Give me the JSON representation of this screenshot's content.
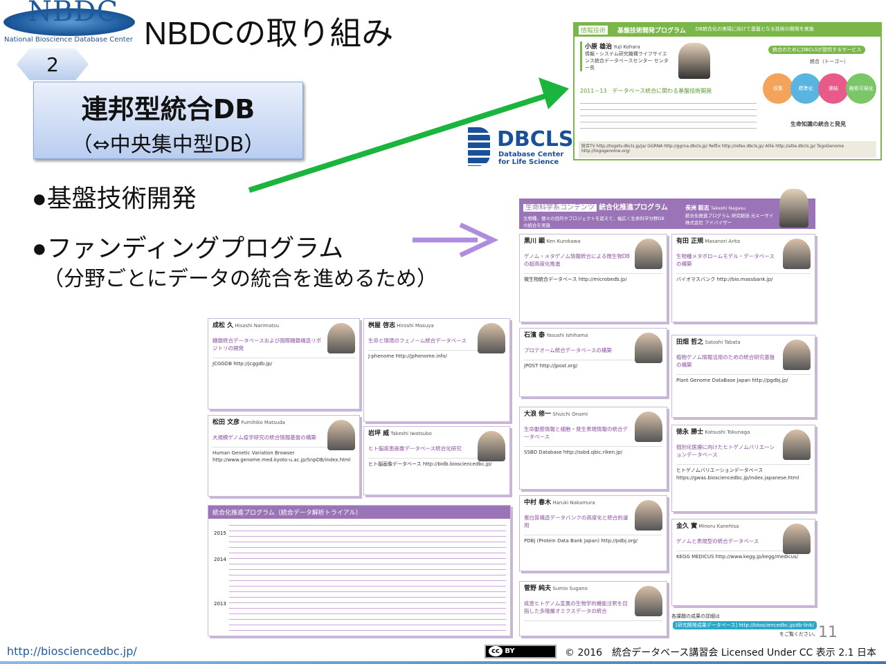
{
  "logo": {
    "text": "NBDC",
    "subtitle": "National Bioscience Database Center"
  },
  "title": "NBDCの取り組み",
  "step_number": "2",
  "box": {
    "line1": "連邦型統合DB",
    "line2": "（⇔中央集中型DB）"
  },
  "bullets": [
    {
      "text": "●基盤技術開発"
    },
    {
      "text": "●ファンディングプログラム",
      "sub": "（分野ごとにデータの統合を進めるため）"
    }
  ],
  "dbcls": {
    "name": "DBCLS",
    "line1": "Database Center",
    "line2": "for Life Science"
  },
  "tech_panel": {
    "tag": "情報技術",
    "title": "基盤技術開発プログラム",
    "desc": "DB統合化の実現に向けて基盤となる技術の開発を実施",
    "person": "小原 雄治",
    "person_en": "Yuji Kohara",
    "affil": "情報・システム研究機構ライフサイエンス統合データベースセンター センター長",
    "period": "2011－13",
    "topic": "データベース統合に関わる基盤技術開発",
    "service_title": "統合のためにDBCLSが提供するサービス",
    "service_sub": "統合（トーゴー）",
    "circles": [
      "収集",
      "標準化",
      "連結",
      "検索可視化"
    ],
    "result": "生命知識の統合と発見",
    "links": "統合TV http://togotv.dbcls.jp/ja/  GGRNA http://ggrna.dbcls.jp/  RefEx http://refex.dbcls.jp/  Allie http://allie.dbcls.jp/  TogoGenome http://togogenome.org/"
  },
  "life_panel": {
    "tag": "生命科学系コンテンツ",
    "title": "統合化推進プログラム",
    "desc": "生物種、個々の目的やプロジェクトを超えて、幅広く生命科学分野DBの統合を実施",
    "person": "長洲 毅志",
    "person_en": "Takeshi Nagasu",
    "role": "統合化推進プログラム 研究総括 元エーザイ株式会社 アドバイザー"
  },
  "cards": [
    {
      "name": "黒川 顕",
      "en": "Ken Kurokawa",
      "topic": "ゲノム・メタゲノム情報統合による微生物DBの超高度化推進",
      "db": "微生物統合データベース http://microbedb.jp/"
    },
    {
      "name": "有田 正規",
      "en": "Masanori Arita",
      "topic": "生物種メタボロームモデル・データベースの構築",
      "db": "バイオマスバンク http://bio.massbank.jp/"
    },
    {
      "name": "石濱 泰",
      "en": "Yasushi Ishihama",
      "topic": "プロテオーム統合データベースの構築",
      "db": "jPOST http://jpost.org/"
    },
    {
      "name": "田畑 哲之",
      "en": "Satoshi Tabata",
      "topic": "植物ゲノム情報活用のための統合研究基盤の構築",
      "db": "Plant Genome DataBase Japan http://pgdbj.jp/"
    },
    {
      "name": "大浪 修一",
      "en": "Shuichi Onami",
      "topic": "生命動態情報と細胞・発生表現情報の統合データベース",
      "db": "SSBD Database http://ssbd.qbic.riken.jp/"
    },
    {
      "name": "徳永 勝士",
      "en": "Katsushi Tokunaga",
      "topic": "個別化医療に向けたヒトゲノムバリエーションデータベース",
      "db": "ヒトゲノムバリエーションデータベース https://gwas.biosciencedbc.jp/index.japanese.html"
    },
    {
      "name": "中村 春木",
      "en": "Haruki Nakamura",
      "topic": "蛋白質構造データバンクの高度化と統合的運用",
      "db": "PDBj (Protein Data Bank Japan) http://pdbj.org/"
    },
    {
      "name": "金久 實",
      "en": "Minoru Kanehisa",
      "topic": "ゲノムと表現型の統合データベース",
      "db": "KEGG MEDICUS http://www.kegg.jp/kegg/medicus/"
    },
    {
      "name": "菅野 純夫",
      "en": "Sumio Sugano",
      "topic": "疾患ヒトゲノム変異の生物学的機能注釈を目指した多階層オミクスデータの統合",
      "db": ""
    },
    {
      "name": "成松 久",
      "en": "Hisashi Narimatsu",
      "topic": "糖鎖統合データベースおよび国際糖鎖構造リポジトリの開発",
      "db": "JCGGDB http://jcggdb.jp/"
    },
    {
      "name": "桝屋 啓志",
      "en": "Hiroshi Masuya",
      "topic": "生命と環境のフェノーム統合データベース",
      "db": "J-phenome http://jphenome.info/"
    },
    {
      "name": "松田 文彦",
      "en": "Fumihiko Matsuda",
      "topic": "大規模ゲノム疫学研究の統合情報基盤の構築",
      "db": "Human Genetic Variation Browser http://www.genome.med.kyoto-u.ac.jp/SnpDB/index.html"
    },
    {
      "name": "岩坪 威",
      "en": "Takeshi Iwatsubo",
      "topic": "ヒト脳疾患画像データベース統合化研究",
      "db": "ヒト脳画像データベース http://bidb.biosciencedbc.jp/"
    }
  ],
  "trial": {
    "title": "統合化推進プログラム（統合データ解析トライアル）",
    "years": [
      "2015",
      "2014",
      "2013"
    ]
  },
  "footer_note": {
    "line1": "各課題の成果の詳細は",
    "link": "[研究開発成果データベース] http://biosciencedbc.jp/db-link/",
    "line2": "をご覧ください。"
  },
  "page_number": "11",
  "url": "http://biosciencedbc.jp/",
  "license_badge": "BY",
  "copyright": "© 2016　統合データベース講習会 Licensed Under CC 表示 2.1 日本",
  "colors": {
    "green": "#19b53c",
    "purple": "#b08ce0",
    "panel_green": "#7ab648",
    "panel_purple": "#9a74b6"
  }
}
